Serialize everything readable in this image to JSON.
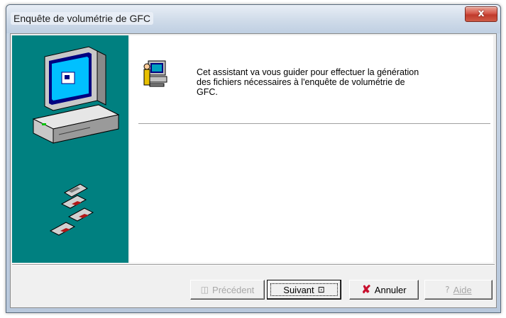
{
  "window": {
    "title": "Enquête de volumétrie de GFC",
    "close_glyph": "x"
  },
  "content": {
    "intro_text": "Cet assistant va vous guider pour effectuer la génération\ndes fichiers nécessaires à l'enquête de volumétrie de\nGFC."
  },
  "sidebar": {
    "background_color": "#008080",
    "illustration": [
      "computer-icon",
      "floppy-disks-icon"
    ]
  },
  "buttons": {
    "previous": {
      "label": "Précédent",
      "icon": "back-arrow-icon",
      "enabled": false
    },
    "next": {
      "label": "Suivant",
      "icon": "next-arrow-icon",
      "enabled": true
    },
    "cancel": {
      "label": "Annuler",
      "icon": "red-x-icon",
      "enabled": true
    },
    "help": {
      "label": "Aide",
      "icon": "question-mark-icon",
      "enabled": false
    }
  }
}
